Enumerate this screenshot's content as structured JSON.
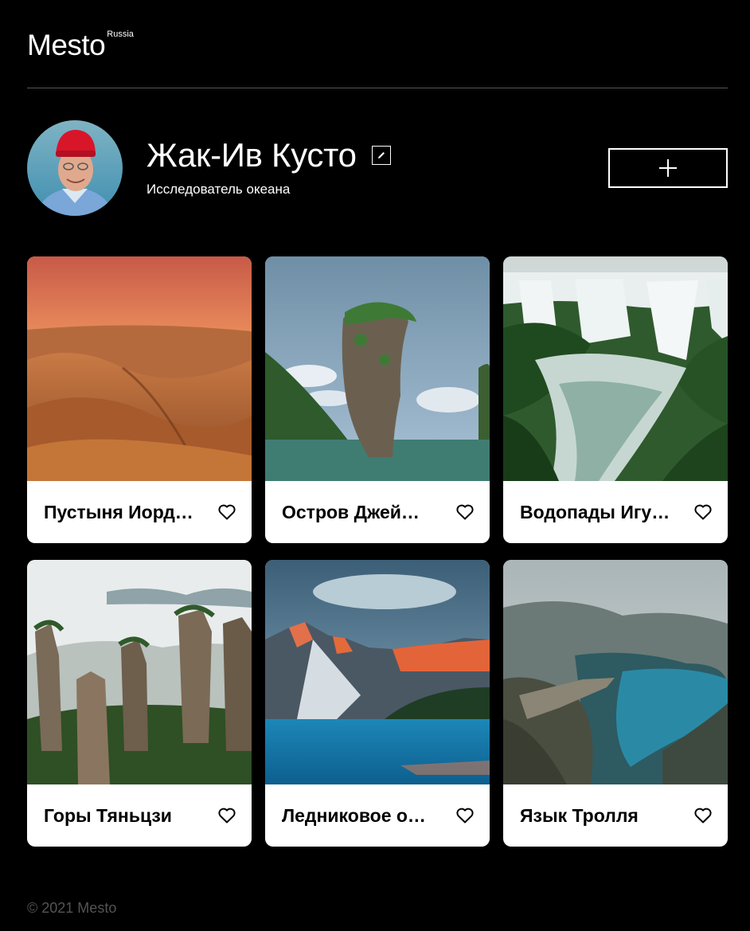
{
  "header": {
    "logo": "Mesto",
    "logo_sup": "Russia"
  },
  "profile": {
    "name": "Жак-Ив Кусто",
    "about": "Исследователь океана",
    "edit_icon": "pencil-icon",
    "add_icon": "plus-icon"
  },
  "cards": [
    {
      "title": "Пустыня Иорд…",
      "scene": "desert"
    },
    {
      "title": "Остров Джей…",
      "scene": "island"
    },
    {
      "title": "Водопады Игу…",
      "scene": "waterfall"
    },
    {
      "title": "Горы Тяньцзи",
      "scene": "pillars"
    },
    {
      "title": "Ледниковое о…",
      "scene": "lake"
    },
    {
      "title": "Язык Тролля",
      "scene": "fjord"
    }
  ],
  "footer": {
    "copyright": "© 2021 Mesto"
  },
  "colors": {
    "background": "#000000",
    "card": "#ffffff",
    "muted": "#545454"
  }
}
